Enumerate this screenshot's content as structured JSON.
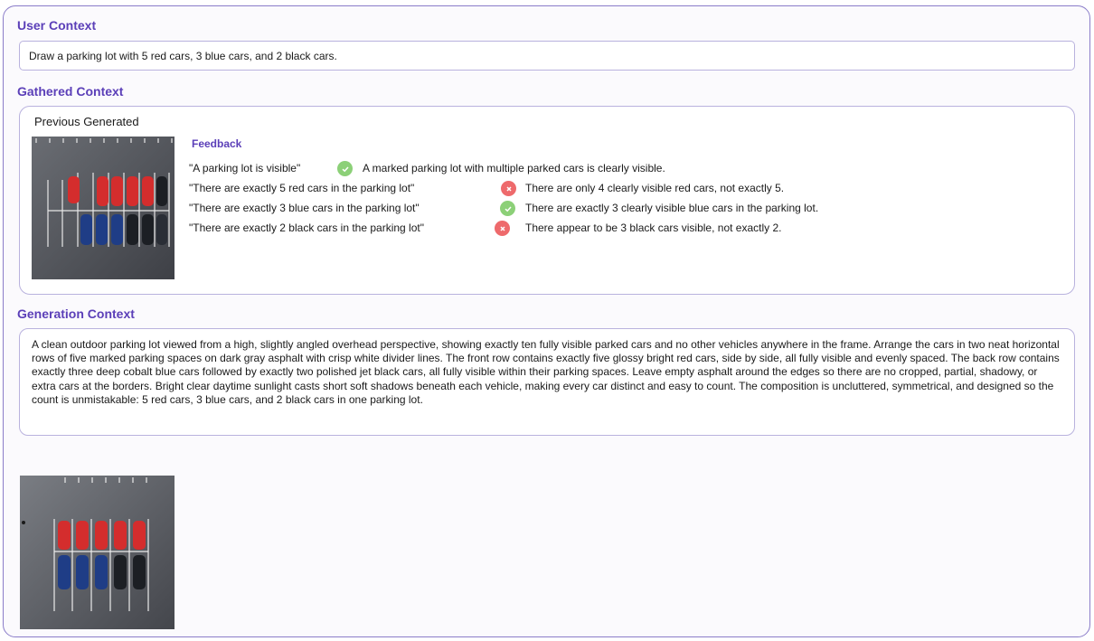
{
  "user_context": {
    "title": "User Context",
    "prompt": "Draw a parking lot with 5 red cars, 3 blue cars, and 2 black cars."
  },
  "gathered_context": {
    "title": "Gathered Context",
    "previous_label": "Previous Generated",
    "feedback_title": "Feedback",
    "feedback": [
      {
        "claim": "\"A parking lot is visible\"",
        "status": "pass",
        "reason": "A marked parking lot with multiple parked cars is clearly visible."
      },
      {
        "claim": "\"There are exactly 5 red cars in the parking lot\"",
        "status": "fail",
        "reason": "There are only 4 clearly visible red cars, not exactly 5."
      },
      {
        "claim": "\"There are exactly 3 blue cars in the parking lot\"",
        "status": "pass",
        "reason": "There are exactly 3 clearly visible blue cars in the parking lot."
      },
      {
        "claim": "\"There are exactly 2 black cars in the parking lot\"",
        "status": "fail",
        "reason": "There appear to be 3 black cars visible, not exactly 2."
      }
    ]
  },
  "generation_context": {
    "title": "Generation Context",
    "prompt": "A clean outdoor parking lot viewed from a high, slightly angled overhead perspective, showing exactly ten fully visible parked cars and no other vehicles anywhere in the frame. Arrange the cars in two neat horizontal rows of five marked parking spaces on dark gray asphalt with crisp white divider lines. The front row contains exactly five glossy bright red cars, side by side, all fully visible and evenly spaced. The back row contains exactly three deep cobalt blue cars followed by exactly two polished jet black cars, all fully visible within their parking spaces. Leave empty asphalt around the edges so there are no cropped, partial, shadowy, or extra cars at the borders. Bright clear daytime sunlight casts short soft shadows beneath each vehicle, making every car distinct and easy to count. The composition is uncluttered, symmetrical, and designed so the count is unmistakable: 5 red cars, 3 blue cars, and 2 black cars in one parking lot."
  },
  "colors": {
    "accent": "#5b3fb8",
    "border": "#b9b2de",
    "pass": "#8cd078",
    "fail": "#ee6a6c",
    "red_car": "#d42d2d",
    "blue_car": "#1f3d86",
    "black_car": "#1c1f24",
    "asphalt": "#4a4c52"
  }
}
